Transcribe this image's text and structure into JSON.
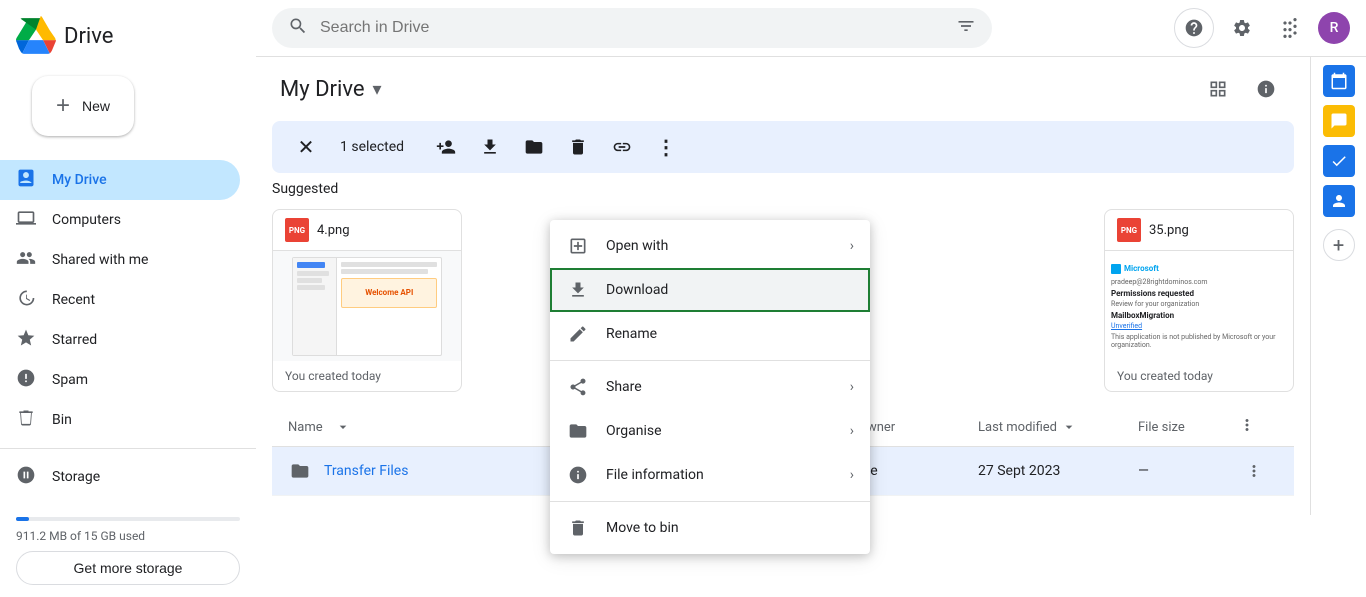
{
  "app": {
    "title": "Drive",
    "logo_alt": "Google Drive"
  },
  "header": {
    "search_placeholder": "Search in Drive",
    "search_value": ""
  },
  "sidebar": {
    "new_button": "New",
    "items": [
      {
        "id": "my-drive",
        "label": "My Drive",
        "active": true
      },
      {
        "id": "computers",
        "label": "Computers",
        "active": false
      },
      {
        "id": "shared",
        "label": "Shared with me",
        "active": false
      },
      {
        "id": "recent",
        "label": "Recent",
        "active": false
      },
      {
        "id": "starred",
        "label": "Starred",
        "active": false
      },
      {
        "id": "spam",
        "label": "Spam",
        "active": false
      },
      {
        "id": "bin",
        "label": "Bin",
        "active": false
      },
      {
        "id": "storage",
        "label": "Storage",
        "active": false
      }
    ],
    "storage_text": "911.2 MB of 15 GB used",
    "get_storage_label": "Get more storage",
    "storage_percent": 6
  },
  "drive": {
    "title": "My Drive",
    "selected_text": "1 selected"
  },
  "toolbar": {
    "close_label": "×",
    "share_icon": "share",
    "download_icon": "download",
    "move_icon": "move",
    "delete_icon": "delete",
    "link_icon": "link",
    "more_icon": "more"
  },
  "suggested_section": "Suggested",
  "file_cards": [
    {
      "name": "4.png",
      "date": "You created today"
    },
    {
      "name": "35.png",
      "date": "You created today"
    }
  ],
  "file_list": {
    "headers": [
      "Name",
      "Owner",
      "Last modified",
      "File size"
    ],
    "rows": [
      {
        "name": "Transfer Files",
        "type": "folder",
        "owner": "me",
        "modified": "27 Sept 2023",
        "size": "—"
      }
    ]
  },
  "context_menu": {
    "items": [
      {
        "id": "open-with",
        "label": "Open with",
        "has_arrow": true,
        "icon": "open"
      },
      {
        "id": "download",
        "label": "Download",
        "has_arrow": false,
        "icon": "download",
        "highlighted": true
      },
      {
        "id": "rename",
        "label": "Rename",
        "has_arrow": false,
        "icon": "edit"
      },
      {
        "id": "share",
        "label": "Share",
        "has_arrow": true,
        "icon": "share"
      },
      {
        "id": "organise",
        "label": "Organise",
        "has_arrow": true,
        "icon": "folder"
      },
      {
        "id": "file-information",
        "label": "File information",
        "has_arrow": true,
        "icon": "info"
      },
      {
        "id": "move-to-bin",
        "label": "Move to bin",
        "has_arrow": false,
        "icon": "delete"
      }
    ]
  },
  "right_panel": {
    "icons": [
      "calendar",
      "chat",
      "check",
      "person"
    ]
  },
  "colors": {
    "selected_bg": "#e8f0fe",
    "accent": "#1a73e8",
    "download_border": "#1e7e34"
  }
}
